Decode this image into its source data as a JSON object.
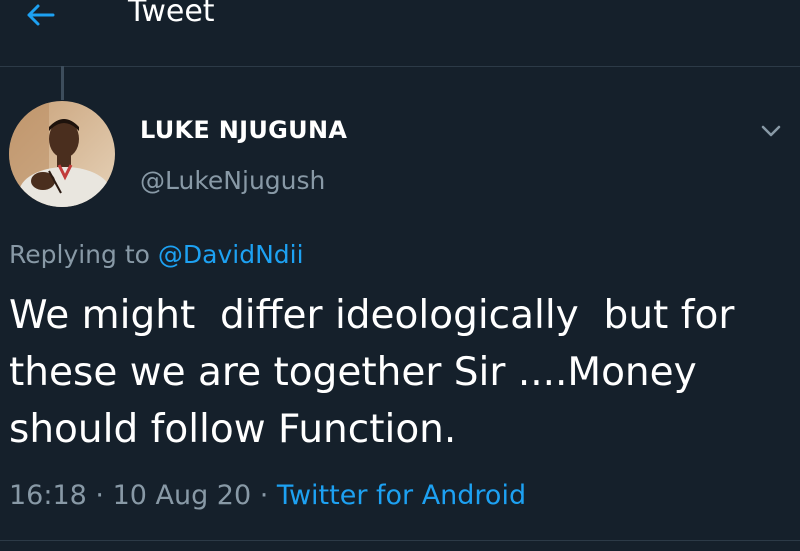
{
  "header": {
    "title": "Tweet"
  },
  "tweet": {
    "author_name": "LUKE NJUGUNA",
    "author_handle": "@LukeNjugush",
    "replying_prefix": "Replying to ",
    "replying_to": "@DavidNdii",
    "text": "We might  differ ideologically  but for these we are together Sir ....Money should follow Function.",
    "time": "16:18",
    "separator": " · ",
    "date": "10 Aug 20",
    "source": "Twitter for Android"
  },
  "icons": {
    "back": "back-arrow-icon",
    "more": "chevron-down-icon",
    "avatar": "user-avatar"
  },
  "colors": {
    "background": "#15202b",
    "accent": "#1da1f2",
    "secondary_text": "#8899a6",
    "primary_text": "#ffffff"
  }
}
